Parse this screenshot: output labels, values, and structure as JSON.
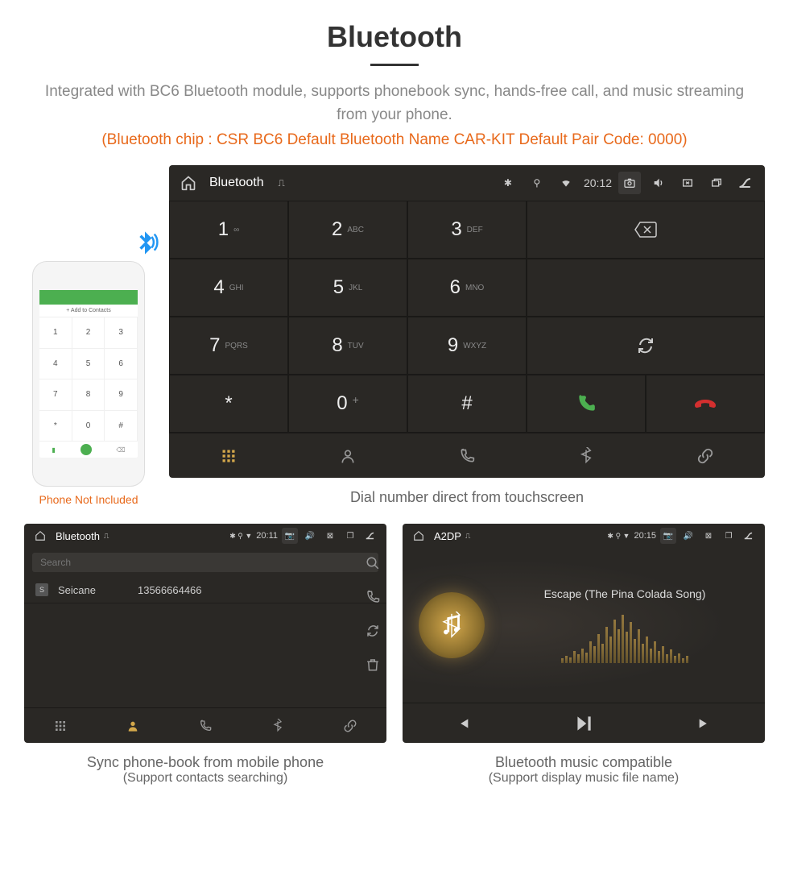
{
  "page": {
    "title": "Bluetooth",
    "subtitle": "Integrated with BC6 Bluetooth module, supports phonebook sync, hands-free call, and music streaming from your phone.",
    "spec": "(Bluetooth chip : CSR BC6    Default Bluetooth Name CAR-KIT    Default Pair Code: 0000)"
  },
  "phone_mock": {
    "add_label": "+  Add to Contacts",
    "note": "Phone Not Included"
  },
  "dialer": {
    "status": {
      "title": "Bluetooth",
      "time": "20:12"
    },
    "keys": [
      {
        "num": "1",
        "letters": "∞"
      },
      {
        "num": "2",
        "letters": "ABC"
      },
      {
        "num": "3",
        "letters": "DEF"
      },
      {
        "num": "4",
        "letters": "GHI"
      },
      {
        "num": "5",
        "letters": "JKL"
      },
      {
        "num": "6",
        "letters": "MNO"
      },
      {
        "num": "7",
        "letters": "PQRS"
      },
      {
        "num": "8",
        "letters": "TUV"
      },
      {
        "num": "9",
        "letters": "WXYZ"
      },
      {
        "num": "*",
        "letters": ""
      },
      {
        "num": "0",
        "letters": "+"
      },
      {
        "num": "#",
        "letters": ""
      }
    ],
    "caption": "Dial number direct from touchscreen"
  },
  "phonebook": {
    "status": {
      "title": "Bluetooth",
      "time": "20:11"
    },
    "search_placeholder": "Search",
    "contact": {
      "badge": "S",
      "name": "Seicane",
      "number": "13566664466"
    },
    "caption": "Sync phone-book from mobile phone",
    "caption_sub": "(Support contacts searching)"
  },
  "music": {
    "status": {
      "title": "A2DP",
      "time": "20:15"
    },
    "song": "Escape (The Pina Colada Song)",
    "caption": "Bluetooth music compatible",
    "caption_sub": "(Support display music file name)"
  }
}
